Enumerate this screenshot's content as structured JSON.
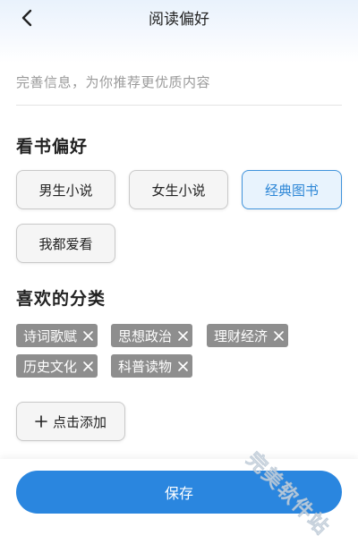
{
  "header": {
    "title": "阅读偏好",
    "back_icon": "chevron-left-icon"
  },
  "subtitle": "完善信息，为你推荐更优质内容",
  "reading_pref": {
    "title": "看书偏好",
    "options": [
      {
        "label": "男生小说",
        "selected": false
      },
      {
        "label": "女生小说",
        "selected": false
      },
      {
        "label": "经典图书",
        "selected": true
      },
      {
        "label": "我都爱看",
        "selected": false
      }
    ]
  },
  "categories": {
    "title": "喜欢的分类",
    "tags": [
      "诗词歌赋",
      "思想政治",
      "理财经济",
      "历史文化",
      "科普读物"
    ],
    "remove_icon": "close-icon",
    "add_label": "点击添加",
    "add_icon": "plus-icon"
  },
  "save_label": "保存",
  "watermark": "完美软件站",
  "colors": {
    "accent": "#2a86df",
    "selected_border": "#3f93dc",
    "selected_bg": "#e8f3fd",
    "tag_bg": "#8e8e8e",
    "subtitle_text": "#9a9a9a"
  }
}
